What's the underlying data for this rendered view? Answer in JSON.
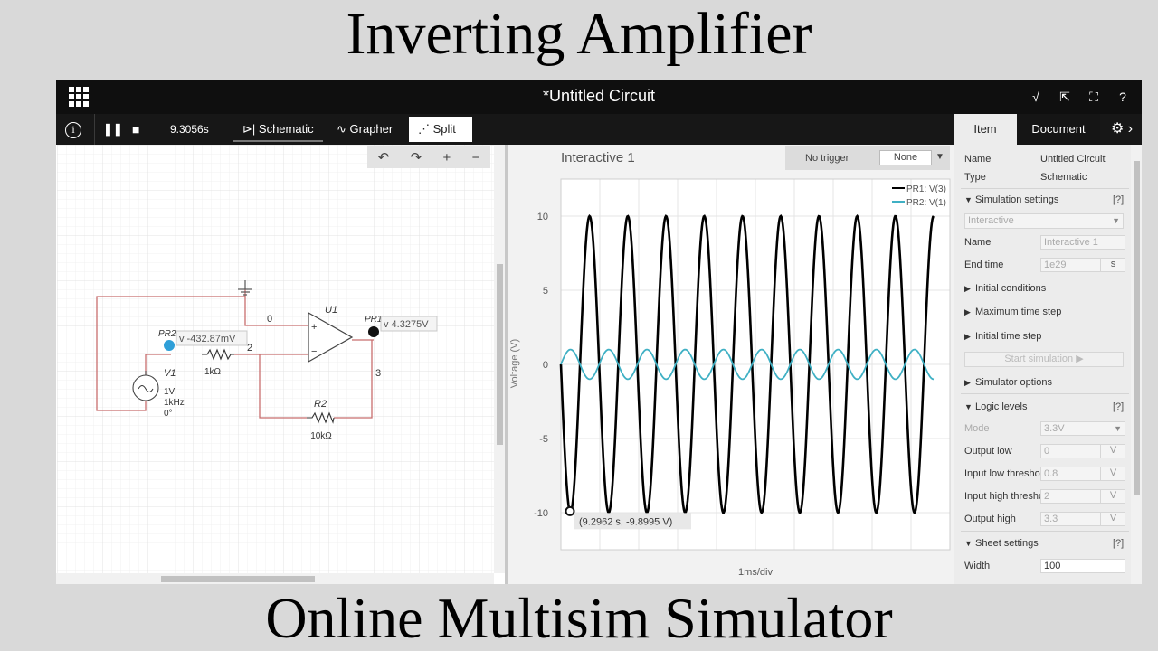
{
  "banner": {
    "top": "Inverting Amplifier",
    "bottom": "Online Multisim Simulator"
  },
  "titlebar": {
    "title_prefix": "*",
    "title": "Untitled Circuit",
    "icons": [
      "grid-menu-icon",
      "sqrt-icon",
      "share-icon",
      "fullscreen-icon",
      "help-icon"
    ],
    "help_label": "?"
  },
  "toolbar": {
    "info_label": "i",
    "pause_label": "❚❚",
    "stop_label": "■",
    "sim_time": "9.3056s",
    "tabs": [
      {
        "label": "Schematic",
        "icon": "diode-icon"
      },
      {
        "label": "Grapher",
        "icon": "wave-icon"
      },
      {
        "label": "Split",
        "icon": "split-icon",
        "active": true
      }
    ]
  },
  "panel_tabs": {
    "item": "Item",
    "document": "Document",
    "active": "Document"
  },
  "schematic": {
    "zoom_controls": [
      "undo-icon",
      "redo-icon",
      "zoom-in-icon",
      "zoom-out-icon"
    ],
    "labels": {
      "net0": "0",
      "u1": "U1",
      "pr1": "PR1",
      "pr1_value": "v 4.3275V",
      "pr2": "PR2",
      "pr2_value": "v -432.87mV",
      "net2": "2",
      "net3": "3",
      "r1_value": "1kΩ",
      "v1": "V1",
      "v1_amp": "1V",
      "v1_freq": "1kHz",
      "v1_phase": "0°",
      "r2": "R2",
      "r2_value": "10kΩ",
      "opamp_plus": "+",
      "opamp_minus": "−"
    }
  },
  "grapher": {
    "title": "Interactive 1",
    "trigger_label": "No trigger",
    "trigger_value": "None",
    "ylabel": "Voltage (V)",
    "xlabel": "1ms/div",
    "cursor_readout": "(9.2962 s, -9.8995 V)",
    "legend": [
      "PR1: V(3)",
      "PR2: V(1)"
    ]
  },
  "chart_data": {
    "type": "line",
    "title": "Interactive 1",
    "xlabel": "1ms/div",
    "ylabel": "Voltage (V)",
    "ylim": [
      -12.5,
      12.5
    ],
    "yticks": [
      10,
      5,
      0,
      -5,
      -10
    ],
    "grid": true,
    "legend_placement": "top-right",
    "x_divisions": 10,
    "series": [
      {
        "name": "PR1: V(3)",
        "color": "#000000",
        "amplitude": 10,
        "frequency_hz": 1000,
        "phase_deg": 180,
        "cycles": 9.75
      },
      {
        "name": "PR2: V(1)",
        "color": "#3fb0c4",
        "amplitude": 1,
        "frequency_hz": 1000,
        "phase_deg": 0,
        "cycles": 9.75
      }
    ],
    "cursor": {
      "x_s": 9.2962,
      "y_v": -9.8995
    }
  },
  "properties": {
    "name_label": "Name",
    "name_value": "Untitled Circuit",
    "type_label": "Type",
    "type_value": "Schematic",
    "sim_settings": "Simulation settings",
    "help": "[?]",
    "mode_select": "Interactive",
    "sim_name_label": "Name",
    "sim_name_value": "Interactive 1",
    "end_time_label": "End time",
    "end_time_value": "1e29",
    "end_time_unit": "s",
    "initial_conditions": "Initial conditions",
    "max_time_step": "Maximum time step",
    "initial_time_step": "Initial time step",
    "start_sim": "Start simulation ▶",
    "simulator_options": "Simulator options",
    "logic_levels": "Logic levels",
    "mode_label": "Mode",
    "mode_value": "3.3V",
    "output_low_label": "Output low",
    "output_low_value": "0",
    "input_low_label": "Input low threshold",
    "input_low_value": "0.8",
    "input_high_label": "Input high threshold",
    "input_high_value": "2",
    "output_high_label": "Output high",
    "output_high_value": "3.3",
    "volt_unit": "V",
    "sheet_settings": "Sheet settings",
    "width_label": "Width",
    "width_value": "100"
  }
}
